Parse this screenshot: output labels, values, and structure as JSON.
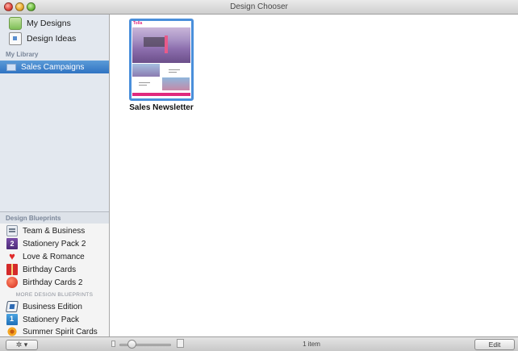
{
  "window": {
    "title": "Design Chooser"
  },
  "sidebar": {
    "top_items": [
      {
        "label": "My Designs",
        "icon": "my-designs-icon"
      },
      {
        "label": "Design Ideas",
        "icon": "design-ideas-icon"
      }
    ],
    "library_header": "My Library",
    "library_items": [
      {
        "label": "Sales Campaigns",
        "icon": "folder-icon",
        "selected": true
      }
    ],
    "blueprints_header": "Design Blueprints",
    "blueprint_items": [
      {
        "label": "Team & Business",
        "icon": "team-business-icon"
      },
      {
        "label": "Stationery Pack 2",
        "icon": "stationery-pack-2-icon"
      },
      {
        "label": "Love & Romance",
        "icon": "heart-icon"
      },
      {
        "label": "Birthday Cards",
        "icon": "gift-icon"
      },
      {
        "label": "Birthday Cards 2",
        "icon": "balloon-icon"
      }
    ],
    "more_header": "MORE DESIGN BLUEPRINTS",
    "more_items": [
      {
        "label": "Business Edition",
        "icon": "business-edition-icon"
      },
      {
        "label": "Stationery Pack",
        "icon": "stationery-pack-icon"
      },
      {
        "label": "Summer Spirit Cards",
        "icon": "sun-icon"
      }
    ]
  },
  "content": {
    "items": [
      {
        "label": "Sales Newsletter",
        "brand": "Tolla"
      }
    ]
  },
  "bottom_bar": {
    "gear_label": "✲ ▾",
    "item_count": "1 item",
    "edit_label": "Edit",
    "zoom_level": 0.2
  },
  "colors": {
    "selection": "#2f73c2",
    "thumbnail_border": "#4a8fdb",
    "accent_pink": "#e0297e"
  }
}
